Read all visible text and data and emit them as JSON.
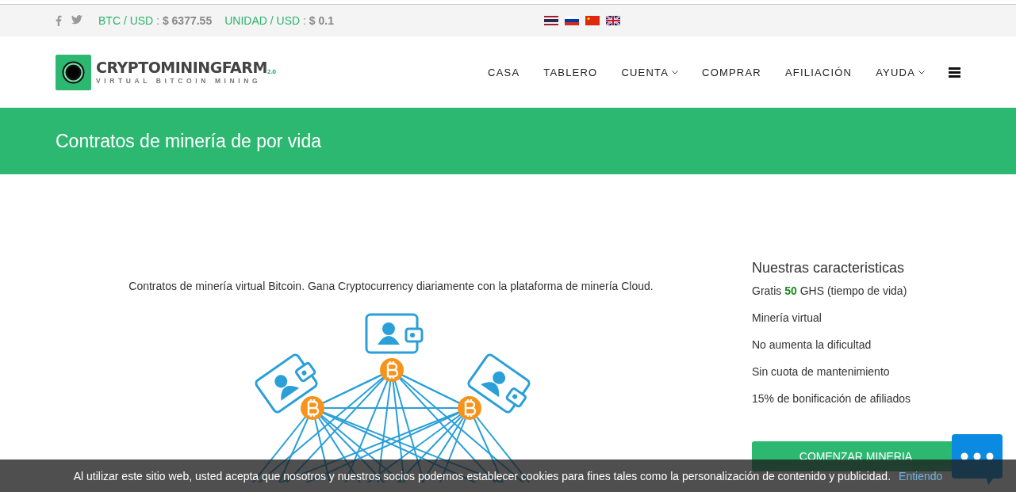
{
  "topbar": {
    "tickers": [
      {
        "label": "BTC / USD",
        "separator": ":",
        "value": "$ 6377.55"
      },
      {
        "label": "UNIDAD / USD",
        "separator": ":",
        "value": "$ 0.1"
      }
    ]
  },
  "logo": {
    "name": "CRYPTOMININGFARM",
    "version": "2.0",
    "tagline": "VIRTUAL BITCOIN MINING"
  },
  "nav": [
    {
      "label": "CASA",
      "dropdown": false
    },
    {
      "label": "TABLERO",
      "dropdown": false
    },
    {
      "label": "CUENTA",
      "dropdown": true
    },
    {
      "label": "COMPRAR",
      "dropdown": false
    },
    {
      "label": "AFILIACIÓN",
      "dropdown": false
    },
    {
      "label": "AYUDA",
      "dropdown": true
    }
  ],
  "banner": {
    "title": "Contratos de minería de por vida"
  },
  "intro": "Contratos de minería virtual Bitcoin. Gana Cryptocurrency diariamente con la plataforma de minería Cloud.",
  "features": {
    "title": "Nuestras caracteristicas",
    "items": [
      "Gratis **50** GHS (tiempo de vida)",
      "Minería virtual",
      "No aumenta la dificultad",
      "Sin cuota de mantenimiento",
      "15% de bonificación de afiliados"
    ],
    "button": "COMENZAR MINERIA"
  },
  "cookie_bar": {
    "text": "Al utilizar este sitio web, usted acepta que nosotros y nuestros socios podemos establecer cookies para fines tales como la personalización de contenido y publicidad.",
    "link": "Entiendo"
  }
}
